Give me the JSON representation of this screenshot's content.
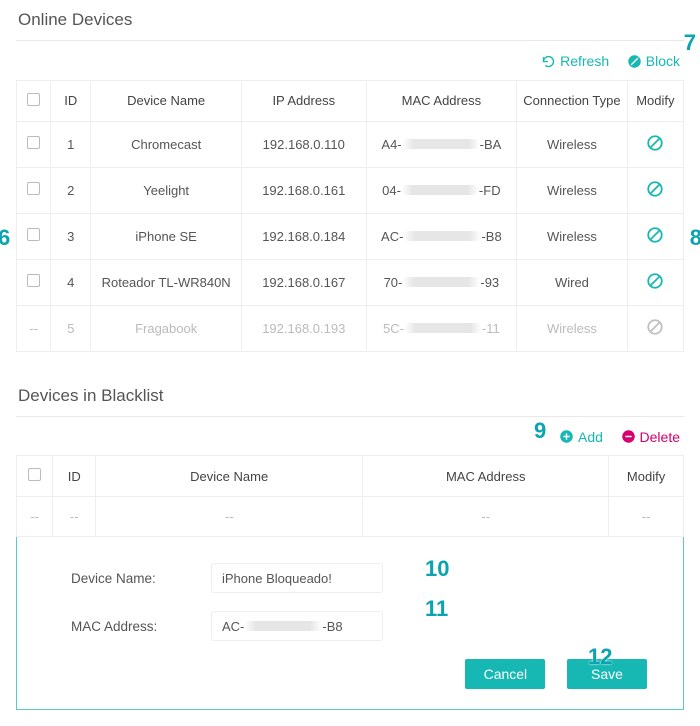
{
  "online": {
    "title": "Online Devices",
    "refresh": "Refresh",
    "block": "Block",
    "columns": {
      "id": "ID",
      "name": "Device Name",
      "ip": "IP Address",
      "mac": "MAC Address",
      "conn": "Connection Type",
      "mod": "Modify"
    },
    "rows": [
      {
        "id": "1",
        "name": "Chromecast",
        "ip": "192.168.0.110",
        "mac_pre": "A4-",
        "mac_suf": "-BA",
        "conn": "Wireless",
        "disabled": false
      },
      {
        "id": "2",
        "name": "Yeelight",
        "ip": "192.168.0.161",
        "mac_pre": "04-",
        "mac_suf": "-FD",
        "conn": "Wireless",
        "disabled": false
      },
      {
        "id": "3",
        "name": "iPhone SE",
        "ip": "192.168.0.184",
        "mac_pre": "AC-",
        "mac_suf": "-B8",
        "conn": "Wireless",
        "disabled": false
      },
      {
        "id": "4",
        "name": "Roteador TL-WR840N",
        "ip": "192.168.0.167",
        "mac_pre": "70-",
        "mac_suf": "-93",
        "conn": "Wired",
        "disabled": false
      },
      {
        "id": "5",
        "name": "Fragabook",
        "ip": "192.168.0.193",
        "mac_pre": "5C-",
        "mac_suf": "-11",
        "conn": "Wireless",
        "disabled": true
      }
    ]
  },
  "blacklist": {
    "title": "Devices in Blacklist",
    "add": "Add",
    "delete": "Delete",
    "columns": {
      "id": "ID",
      "name": "Device Name",
      "mac": "MAC Address",
      "mod": "Modify"
    },
    "empty": "--",
    "form": {
      "name_label": "Device Name:",
      "name_value": "iPhone Bloqueado!",
      "mac_label": "MAC Address:",
      "mac_pre": "AC-",
      "mac_suf": "-B8",
      "cancel": "Cancel",
      "save": "Save"
    }
  },
  "annotations": {
    "6": "6",
    "7": "7",
    "8": "8",
    "9": "9",
    "10": "10",
    "11": "11",
    "12": "12"
  },
  "colors": {
    "accent": "#17b8b3",
    "delete": "#d6006e"
  }
}
